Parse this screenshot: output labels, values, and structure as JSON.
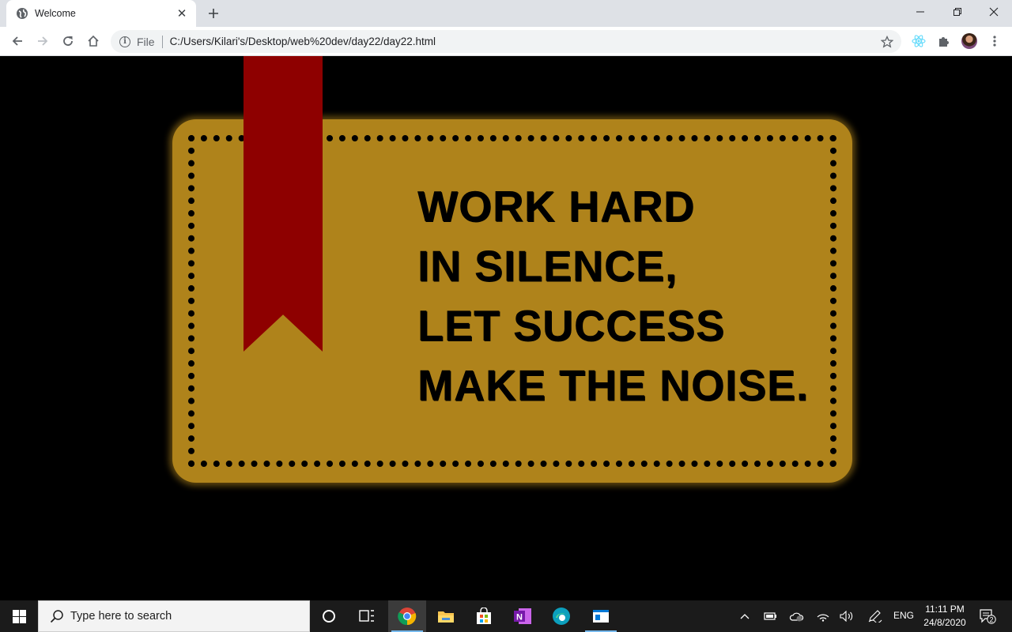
{
  "browser": {
    "tab": {
      "title": "Welcome",
      "favicon": "globe-icon",
      "close_icon": "close-icon"
    },
    "new_tab_icon": "plus-icon",
    "window_controls": [
      "minimize-icon",
      "restore-icon",
      "close-icon"
    ],
    "toolbar": {
      "back_icon": "back-arrow-icon",
      "forward_icon": "forward-arrow-icon",
      "reload_icon": "reload-icon",
      "home_icon": "home-icon"
    },
    "omnibox": {
      "scheme_label": "File",
      "url": "C:/Users/Kilari's/Desktop/web%20dev/day22/day22.html",
      "info_icon": "info-icon",
      "bookmark_icon": "star-icon"
    },
    "extensions": [
      "react-devtools-icon",
      "puzzle-icon"
    ],
    "menu_icon": "kebab-menu-icon"
  },
  "page": {
    "quote_lines": [
      "WORK HARD",
      "IN SILENCE,",
      "LET SUCCESS",
      "MAKE THE NOISE."
    ],
    "colors": {
      "background": "#000000",
      "card": "#af831b",
      "ribbon": "#8e0000",
      "text": "#000000"
    }
  },
  "taskbar": {
    "search_placeholder": "Type here to search",
    "apps": [
      "cortana-icon",
      "task-view-icon",
      "chrome-icon",
      "file-explorer-icon",
      "microsoft-store-icon",
      "onenote-icon",
      "edge-icon",
      "app-window-icon"
    ],
    "tray": [
      "chevron-up-icon",
      "battery-icon",
      "onedrive-icon",
      "wifi-icon",
      "volume-icon",
      "pen-icon"
    ],
    "language": "ENG",
    "time": "11:11 PM",
    "date": "24/8/2020",
    "notification_count": "2"
  }
}
